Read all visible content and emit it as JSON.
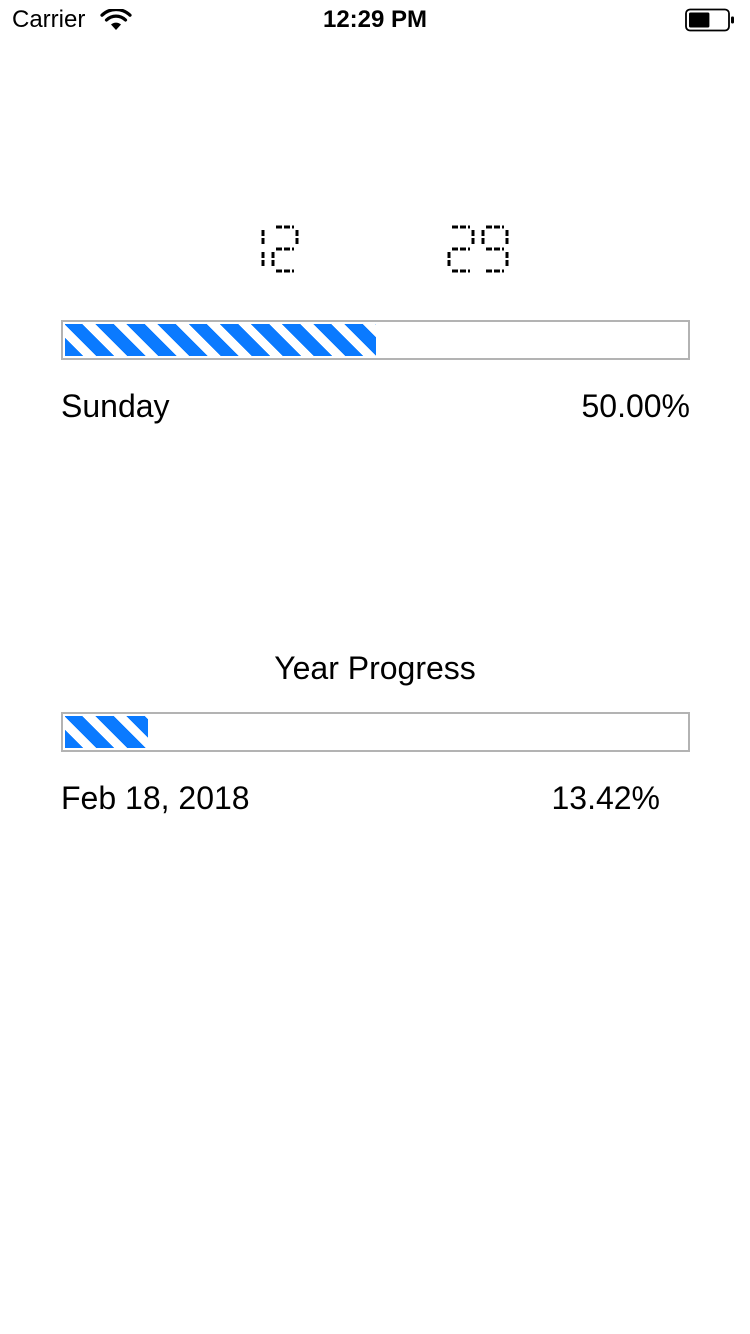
{
  "status_bar": {
    "carrier": "Carrier",
    "time": "12:29 PM",
    "wifi_icon": "wifi-icon",
    "battery_icon": "battery-icon",
    "battery_level": 0.55
  },
  "clock": {
    "hours": "12",
    "minutes": "29",
    "digit_color": "#000000"
  },
  "day_progress": {
    "label": "Sunday",
    "percent_text": "50.00%",
    "value": 0.5,
    "fill_color": "#0a7aff"
  },
  "year_progress": {
    "title": "Year Progress",
    "date": "Feb 18, 2018",
    "percent_text": "13.42%",
    "value": 0.1342,
    "fill_color": "#0a7aff"
  }
}
